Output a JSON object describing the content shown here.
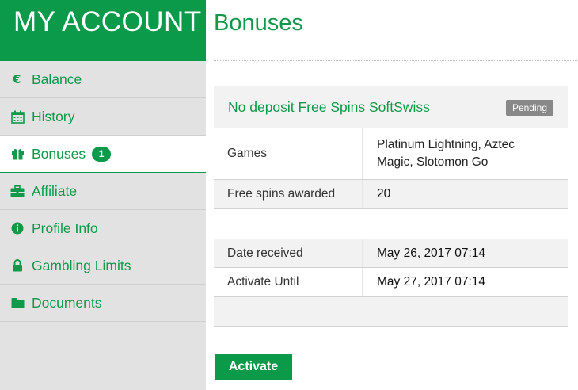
{
  "sidebar": {
    "header": "MY ACCOUNT",
    "items": [
      {
        "label": "Balance",
        "icon": "euro-icon"
      },
      {
        "label": "History",
        "icon": "calendar-icon"
      },
      {
        "label": "Bonuses",
        "icon": "gift-icon",
        "badge": "1",
        "active": true
      },
      {
        "label": "Affiliate",
        "icon": "briefcase-icon"
      },
      {
        "label": "Profile Info",
        "icon": "info-icon"
      },
      {
        "label": "Gambling Limits",
        "icon": "lock-icon"
      },
      {
        "label": "Documents",
        "icon": "folder-icon"
      }
    ]
  },
  "main": {
    "title": "Bonuses",
    "bonus": {
      "name": "No deposit Free Spins SoftSwiss",
      "status": "Pending",
      "rows": {
        "games_label": "Games",
        "games_value": "Platinum Lightning, Aztec Magic, Slotomon Go",
        "spins_label": "Free spins awarded",
        "spins_value": "20",
        "date_label": "Date received",
        "date_value": "May 26, 2017 07:14",
        "until_label": "Activate Until",
        "until_value": "May 27, 2017 07:14"
      }
    },
    "activate_label": "Activate"
  },
  "colors": {
    "brand_green": "#0a9a4a",
    "sidebar_bg": "#e2e2e2",
    "status_grey": "#888888"
  }
}
